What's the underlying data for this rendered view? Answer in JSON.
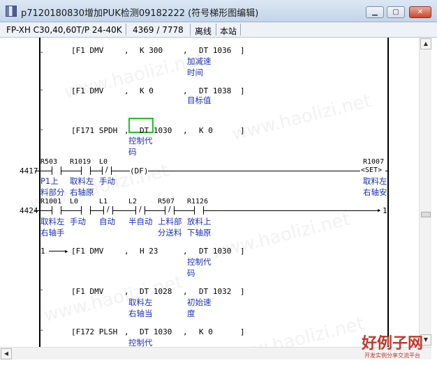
{
  "window": {
    "title": "p7120180830增加PUK检测09182222 (符号梯形图编辑)",
    "buttons": {
      "minimize": "▁",
      "maximize": "▢",
      "close": "✕"
    }
  },
  "status": {
    "plc_model": "FP-XH C30,40,60T/P 24-40K",
    "step_position": "4369  /  7778",
    "mode": "离线",
    "station": "本站"
  },
  "ladder": {
    "instructions": [
      {
        "fn": "[F1 DMV",
        "arg1": "K 300",
        "arg2": "DT 1036",
        "close": "]"
      },
      {
        "fn": "[F1 DMV",
        "arg1": "K 0",
        "arg2": "DT 1038",
        "close": "]"
      },
      {
        "fn": "[F171 SPDH",
        "arg1": "DT 1030",
        "arg2": "K 0",
        "close": "]"
      },
      {
        "fn": "[F1 DMV",
        "arg1": "H 23",
        "arg2": "DT 1030",
        "close": "]"
      },
      {
        "fn": "[F1 DMV",
        "arg1": "DT 1028",
        "arg2": "DT 1032",
        "close": "]"
      },
      {
        "fn": "[F172 PLSH",
        "arg1": "DT 1030",
        "arg2": "K 0",
        "close": "]"
      }
    ],
    "comments": {
      "accel_time_1": "加减速",
      "accel_time_2": "时间",
      "target_value": "目标值",
      "control_code_1": "控制代",
      "control_code_2": "码",
      "rung_4417_c1_1": "P1上",
      "rung_4417_c1_2": "料部分",
      "rung_4417_c2_1": "取料左",
      "rung_4417_c2_2": "右轴原",
      "rung_4417_c3": "手动",
      "rung_4417_out_1": "取料左",
      "rung_4417_out_2": "右轴安",
      "rung_4424_c1_1": "取料左",
      "rung_4424_c1_2": "右轴手",
      "rung_4424_c2": "手动",
      "rung_4424_c3": "自动",
      "rung_4424_c4": "半自动",
      "rung_4424_c5_1": "上料部",
      "rung_4424_c5_2": "分送料",
      "rung_4424_c6_1": "放料上",
      "rung_4424_c6_2": "下轴原",
      "ctrl_code_b_1": "控制代",
      "ctrl_code_b_2": "码",
      "pick_axis_1": "取料左",
      "pick_axis_2": "右轴当",
      "initial_speed_1": "初始速",
      "initial_speed_2": "度",
      "ctrl_code_c": "控制代"
    },
    "rung_4417": {
      "step": "4417",
      "contacts": [
        "R503",
        "R1019",
        "L0"
      ],
      "df": "(DF)",
      "coil": "R1007",
      "coil_instr": "<SET>"
    },
    "rung_4424": {
      "step": "4424",
      "contacts": [
        "R1001",
        "L0",
        "L1",
        "L2",
        "R507",
        "R1126"
      ],
      "jump_out": "1"
    },
    "continuation_in": "1"
  },
  "brand": {
    "main": "好例子网",
    "sub": "开发实例分享交流平台"
  },
  "watermark": "www.haolizi.net"
}
